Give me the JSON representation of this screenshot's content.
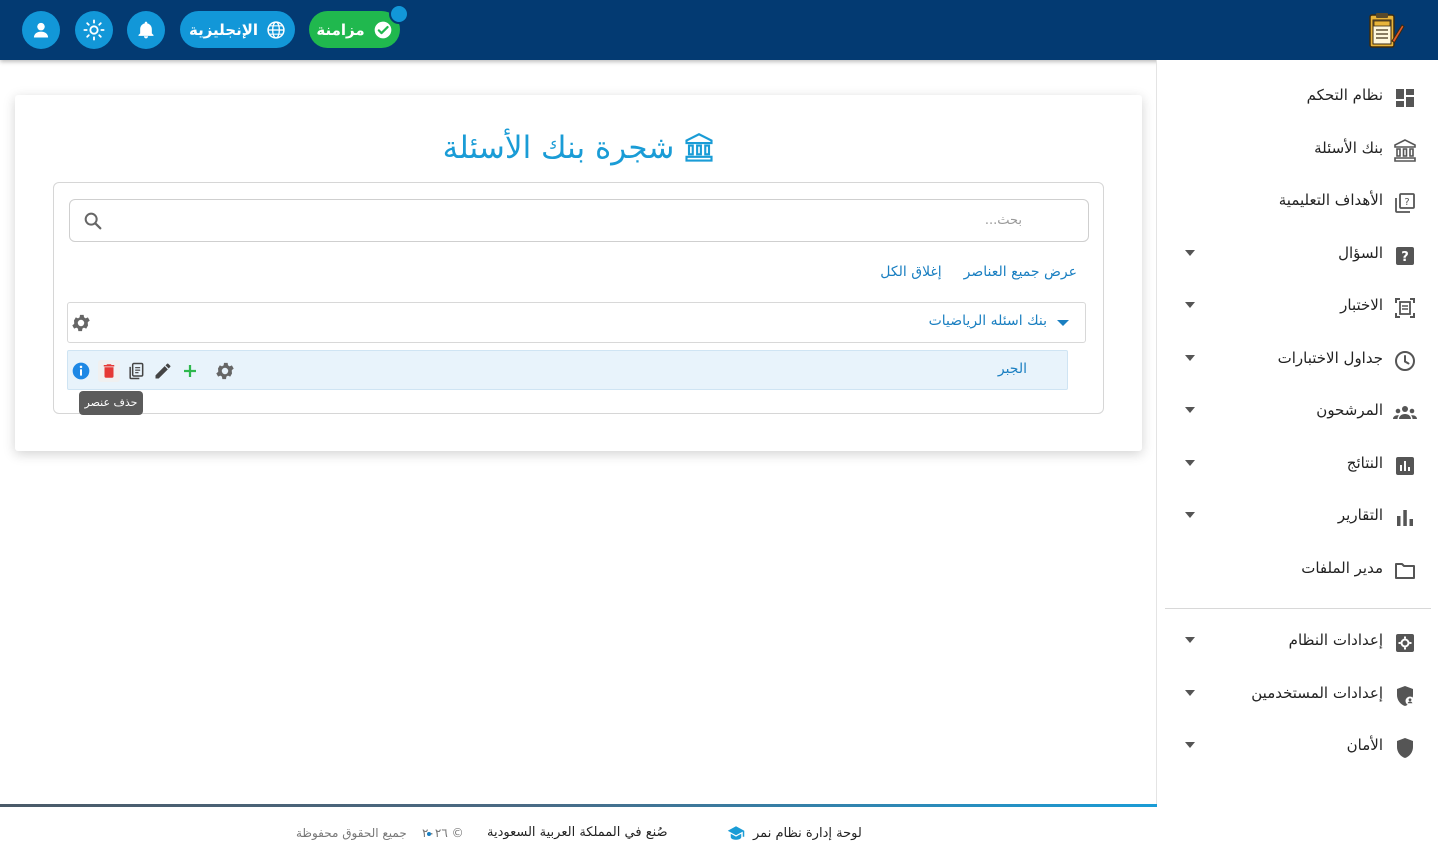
{
  "header": {
    "sync_label": "مزامنة",
    "language_label": "الإنجليزية",
    "icons": [
      "user-icon",
      "theme-sun-icon",
      "bell-icon",
      "globe-icon",
      "check-circle-icon",
      "exam-logo"
    ]
  },
  "sidebar": {
    "items": [
      {
        "label": "نظام التحكم",
        "icon": "dashboard-icon",
        "has_submenu": false
      },
      {
        "label": "بنك الأسئلة",
        "icon": "bank-icon",
        "has_submenu": false
      },
      {
        "label": "الأهداف التعليمية",
        "icon": "quiz-icon",
        "has_submenu": false
      },
      {
        "label": "السؤال",
        "icon": "help-box-icon",
        "has_submenu": true
      },
      {
        "label": "الاختبار",
        "icon": "document-scan-icon",
        "has_submenu": true
      },
      {
        "label": "جداول الاختبارات",
        "icon": "clock-icon",
        "has_submenu": true
      },
      {
        "label": "المرشحون",
        "icon": "group-icon",
        "has_submenu": true
      },
      {
        "label": "النتائج",
        "icon": "poll-icon",
        "has_submenu": true
      },
      {
        "label": "التقارير",
        "icon": "bar-chart-icon",
        "has_submenu": true
      },
      {
        "label": "مدير الملفات",
        "icon": "folder-icon",
        "has_submenu": false
      },
      {
        "label": "إعدادات النظام",
        "icon": "settings-box-icon",
        "has_submenu": true
      },
      {
        "label": "إعدادات المستخدمين",
        "icon": "shield-user-icon",
        "has_submenu": true
      },
      {
        "label": "الأمان",
        "icon": "shield-icon",
        "has_submenu": true
      }
    ]
  },
  "main": {
    "title": "شجرة بنك الأسئلة",
    "search_placeholder": "بحث...",
    "expand_all": "عرض جميع العناصر",
    "collapse_all": "إغلاق الكل",
    "tree": {
      "root_label": "بنك اسئله الرياضيات",
      "child_label": "الجبر"
    },
    "tooltip": "حذف عنصر"
  },
  "footer": {
    "brand": "لوحة إدارة نظام نمر",
    "made_in": "صُنع في المملكة العربية السعودية",
    "copyright": "© ٢٠٢٦ · جميع الحقوق محفوظة",
    "copyright_year": "© ٢٠٢٦",
    "rights": "جميع الحقوق محفوظة"
  },
  "colors": {
    "topbar": "#033a72",
    "accent": "#1a9cd6",
    "sync_green": "#20b84e",
    "delete_red": "#e53935",
    "add_green": "#2eb84d",
    "info_blue": "#1e88e5"
  }
}
